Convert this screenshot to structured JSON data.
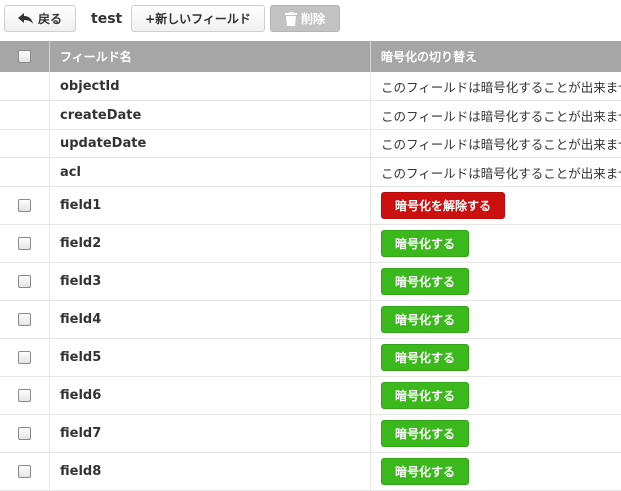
{
  "toolbar": {
    "back_label": "戻る",
    "collection_name": "test",
    "add_field_label": "+新しいフィールド",
    "delete_label": "削除"
  },
  "table": {
    "headers": {
      "field_name": "フィールド名",
      "encryption_toggle": "暗号化の切り替え"
    },
    "system_rows": [
      {
        "name": "objectId",
        "note": "このフィールドは暗号化することが出来ません"
      },
      {
        "name": "createDate",
        "note": "このフィールドは暗号化することが出来ません"
      },
      {
        "name": "updateDate",
        "note": "このフィールドは暗号化することが出来ません"
      },
      {
        "name": "acl",
        "note": "このフィールドは暗号化することが出来ません"
      }
    ],
    "field_rows": [
      {
        "name": "field1",
        "action": "暗号化を解除する",
        "state": "encrypted"
      },
      {
        "name": "field2",
        "action": "暗号化する",
        "state": "plain"
      },
      {
        "name": "field3",
        "action": "暗号化する",
        "state": "plain"
      },
      {
        "name": "field4",
        "action": "暗号化する",
        "state": "plain"
      },
      {
        "name": "field5",
        "action": "暗号化する",
        "state": "plain"
      },
      {
        "name": "field6",
        "action": "暗号化する",
        "state": "plain"
      },
      {
        "name": "field7",
        "action": "暗号化する",
        "state": "plain"
      },
      {
        "name": "field8",
        "action": "暗号化する",
        "state": "plain"
      }
    ]
  },
  "colors": {
    "encrypt": "#3bb81c",
    "decrypt": "#cc1010",
    "header_bg": "#a6a6a6"
  },
  "icons": {
    "back": "back-arrow-icon",
    "delete": "trash-icon"
  }
}
